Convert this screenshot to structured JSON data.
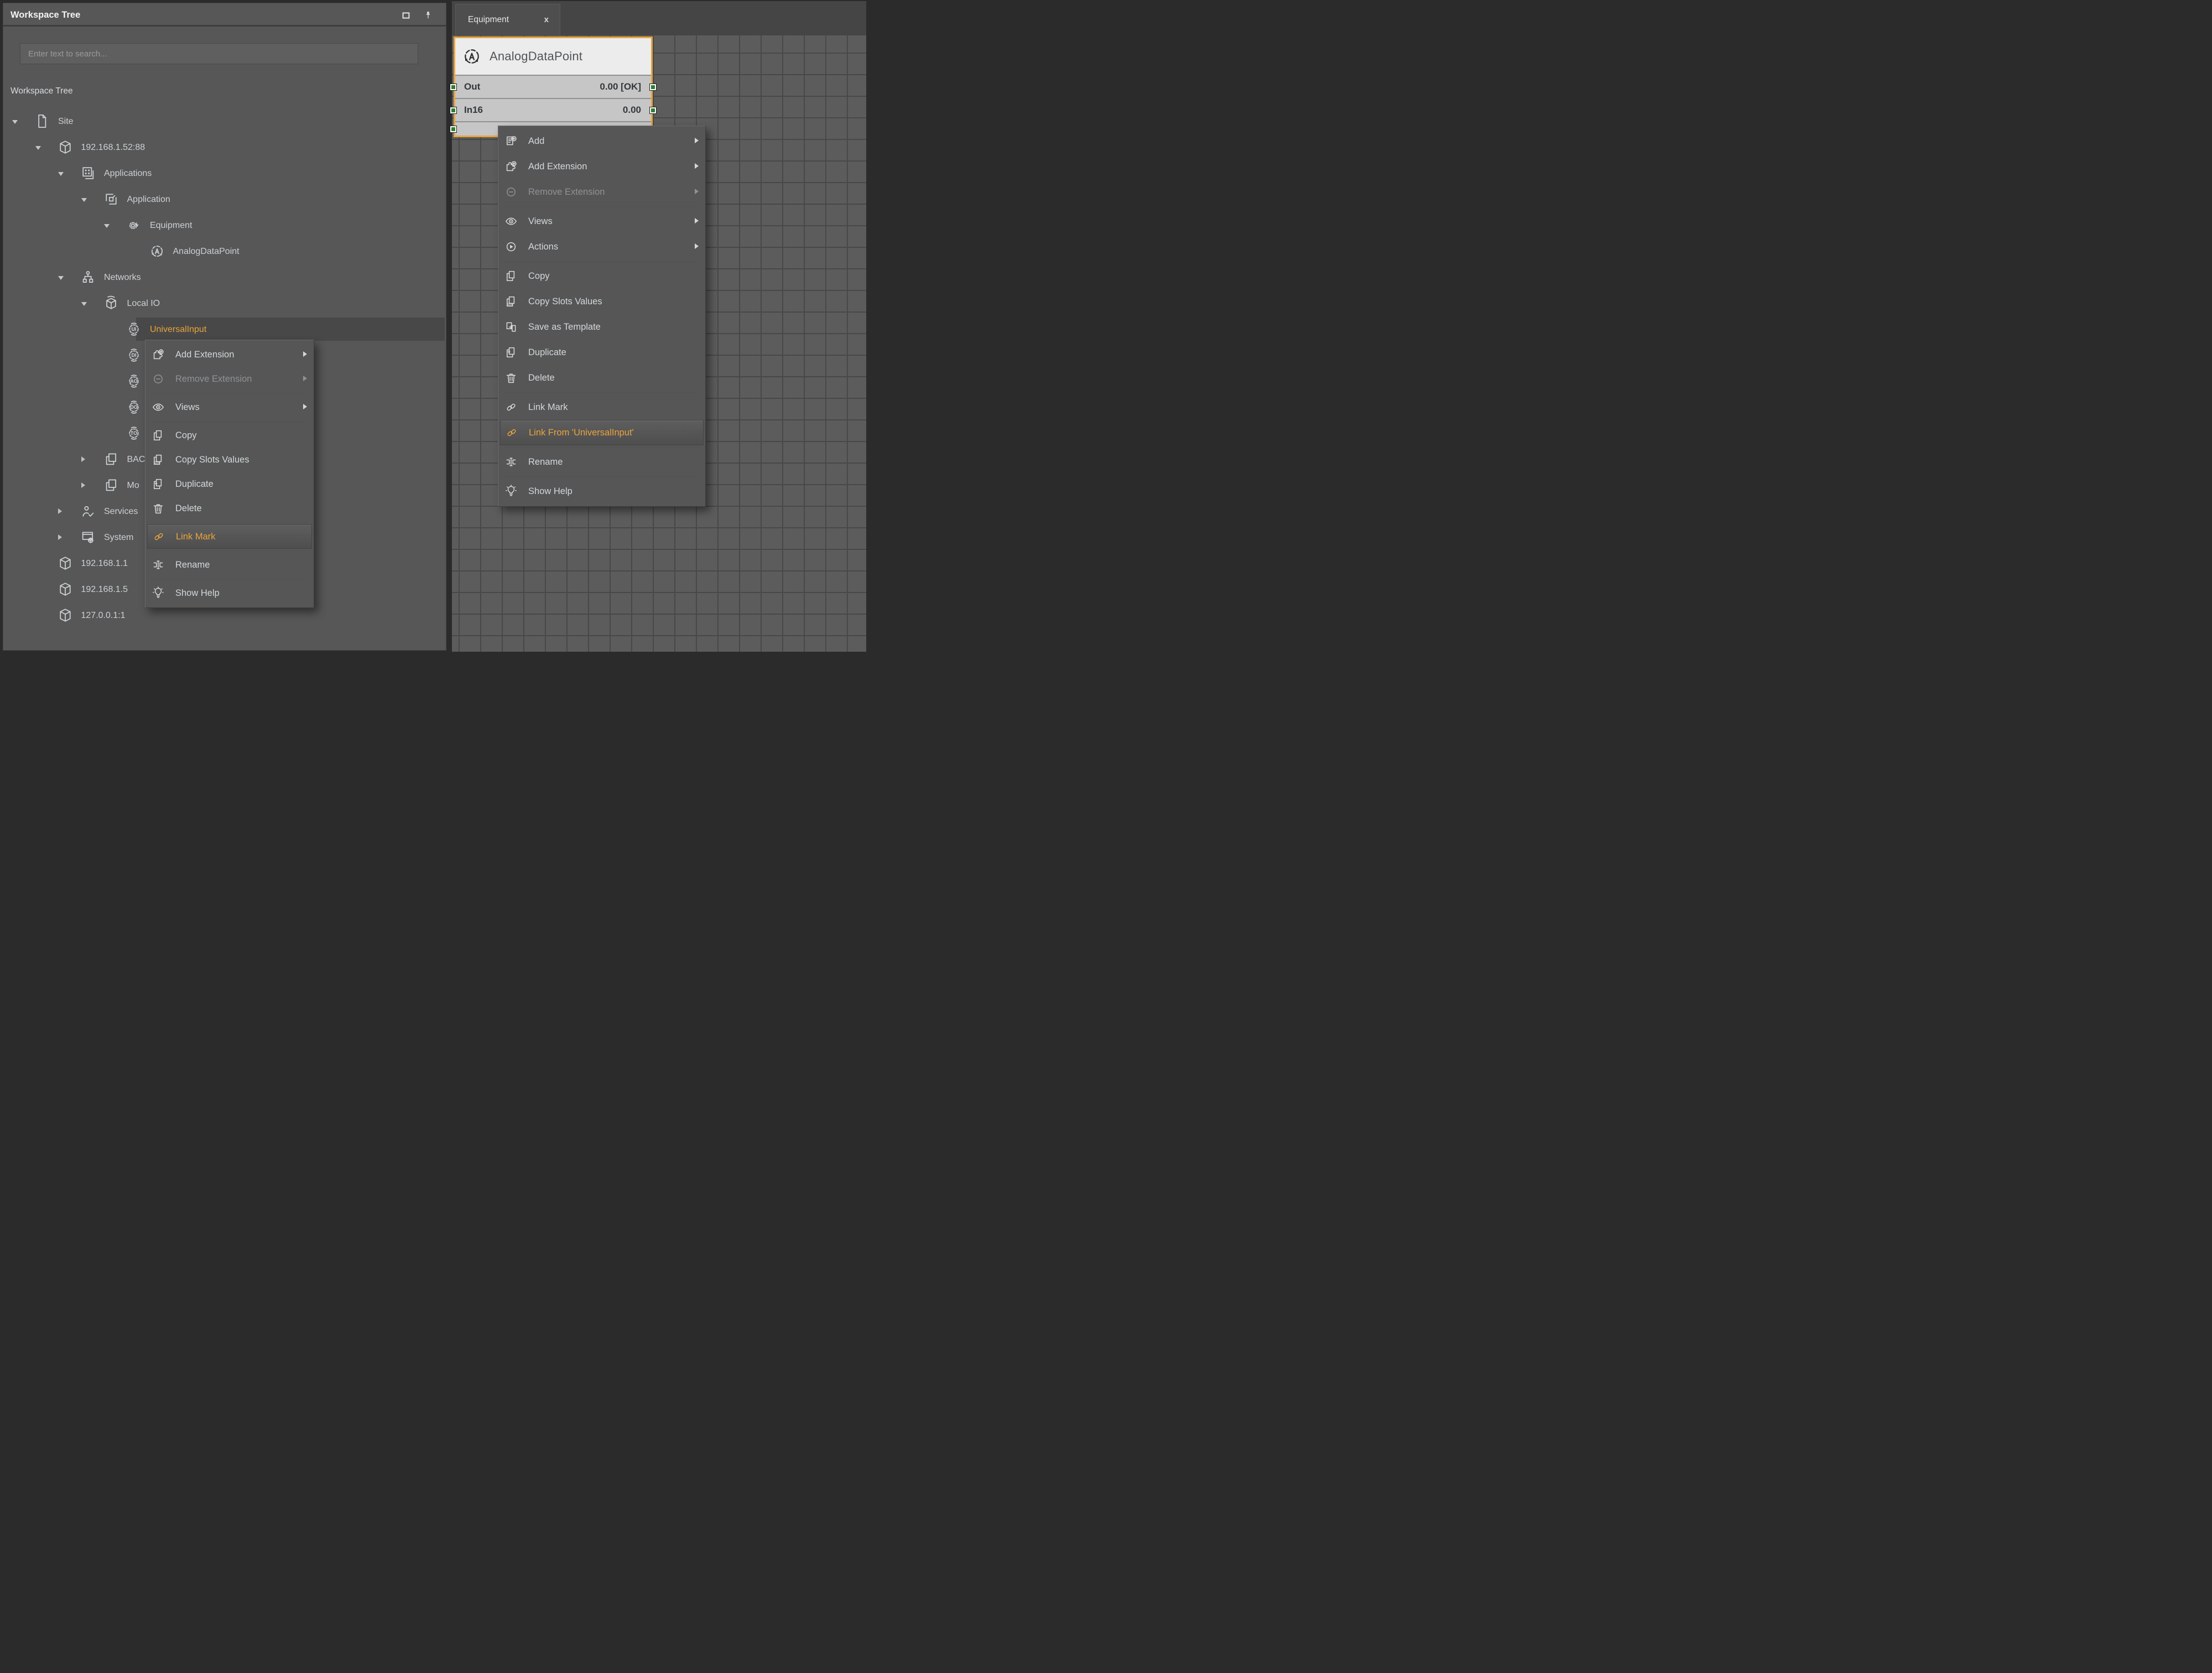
{
  "colors": {
    "accent": "#E9A43C",
    "connector_green": "#2E7D32",
    "block_header_bg": "#ECECEC",
    "slot_row_bg": "#C6C6C6",
    "canvas_bg": "#5C5C5C",
    "grid_line": "#484848",
    "panel_bg": "#575757",
    "menu_bg": "#565656",
    "selected_row_bg": "#484848"
  },
  "left_panel": {
    "title": "Workspace Tree",
    "search_placeholder": "Enter text to search...",
    "section_label": "Workspace Tree",
    "tree": [
      {
        "label": "Site",
        "level": 0,
        "state": "expanded",
        "icon": "page"
      },
      {
        "label": "192.168.1.52:88",
        "level": 1,
        "state": "expanded",
        "icon": "cube"
      },
      {
        "label": "Applications",
        "level": 2,
        "state": "expanded",
        "icon": "apps"
      },
      {
        "label": "Application",
        "level": 3,
        "state": "expanded",
        "icon": "app"
      },
      {
        "label": "Equipment",
        "level": 4,
        "state": "expanded",
        "icon": "gear"
      },
      {
        "label": "AnalogDataPoint",
        "level": 5,
        "state": "leaf",
        "icon": "analog"
      },
      {
        "label": "Networks",
        "level": 2,
        "state": "expanded",
        "icon": "networks"
      },
      {
        "label": "Local IO",
        "level": 3,
        "state": "expanded",
        "icon": "lio"
      },
      {
        "label": "UniversalInput",
        "level": 4,
        "state": "leaf",
        "icon": "io",
        "letters": "UI",
        "selected": true
      },
      {
        "label": "",
        "level": 4,
        "state": "leaf",
        "icon": "io",
        "letters": "DI"
      },
      {
        "label": "",
        "level": 4,
        "state": "leaf",
        "icon": "io",
        "letters": "AO"
      },
      {
        "label": "",
        "level": 4,
        "state": "leaf",
        "icon": "io",
        "letters": "DO"
      },
      {
        "label": "",
        "level": 4,
        "state": "leaf",
        "icon": "io",
        "letters": "TO"
      },
      {
        "label": "BAC",
        "level": 3,
        "state": "collapsed",
        "icon": "folders"
      },
      {
        "label": "Mo",
        "level": 3,
        "state": "collapsed",
        "icon": "folders"
      },
      {
        "label": "Services",
        "level": 2,
        "state": "collapsed",
        "icon": "services"
      },
      {
        "label": "System",
        "level": 2,
        "state": "collapsed",
        "icon": "system"
      },
      {
        "label": "192.168.1.1",
        "level": 1,
        "state": "leaf",
        "icon": "cube"
      },
      {
        "label": "192.168.1.5",
        "level": 1,
        "state": "leaf",
        "icon": "cube"
      },
      {
        "label": "127.0.0.1:1",
        "level": 1,
        "state": "leaf",
        "icon": "cube"
      }
    ]
  },
  "tree_context_menu": {
    "items": [
      {
        "label": "Add Extension",
        "icon": "addext",
        "submenu": true
      },
      {
        "label": "Remove Extension",
        "icon": "remext",
        "submenu": true,
        "disabled": true
      },
      {
        "type": "separator"
      },
      {
        "label": "Views",
        "icon": "views",
        "submenu": true
      },
      {
        "type": "separator"
      },
      {
        "label": "Copy",
        "icon": "copy"
      },
      {
        "label": "Copy Slots Values",
        "icon": "copyslots"
      },
      {
        "label": "Duplicate",
        "icon": "duplicate"
      },
      {
        "label": "Delete",
        "icon": "delete"
      },
      {
        "type": "separator"
      },
      {
        "label": "Link Mark",
        "icon": "link",
        "highlighted": true
      },
      {
        "type": "separator"
      },
      {
        "label": "Rename",
        "icon": "rename"
      },
      {
        "type": "separator"
      },
      {
        "label": "Show Help",
        "icon": "help"
      }
    ]
  },
  "canvas_panel": {
    "tab": {
      "label": "Equipment",
      "close_label": "x"
    },
    "block": {
      "title": "AnalogDataPoint",
      "slots": [
        {
          "name": "Out",
          "value": "0.00 [OK]"
        },
        {
          "name": "In16",
          "value": "0.00"
        },
        {
          "name": "",
          "value": ""
        }
      ]
    },
    "block_context_menu": {
      "items": [
        {
          "label": "Add",
          "icon": "add",
          "submenu": true
        },
        {
          "label": "Add Extension",
          "icon": "addext",
          "submenu": true
        },
        {
          "label": "Remove Extension",
          "icon": "remext",
          "submenu": true,
          "disabled": true
        },
        {
          "type": "separator"
        },
        {
          "label": "Views",
          "icon": "views",
          "submenu": true
        },
        {
          "label": "Actions",
          "icon": "actions",
          "submenu": true
        },
        {
          "type": "separator"
        },
        {
          "label": "Copy",
          "icon": "copy"
        },
        {
          "label": "Copy Slots Values",
          "icon": "copyslots"
        },
        {
          "label": "Save as Template",
          "icon": "saveas"
        },
        {
          "label": "Duplicate",
          "icon": "duplicate"
        },
        {
          "label": "Delete",
          "icon": "delete"
        },
        {
          "type": "separator"
        },
        {
          "label": "Link Mark",
          "icon": "link"
        },
        {
          "label": "Link From 'UniversalInput'",
          "icon": "link",
          "highlighted": true
        },
        {
          "type": "separator"
        },
        {
          "label": "Rename",
          "icon": "rename"
        },
        {
          "type": "separator"
        },
        {
          "label": "Show Help",
          "icon": "help"
        }
      ]
    }
  }
}
